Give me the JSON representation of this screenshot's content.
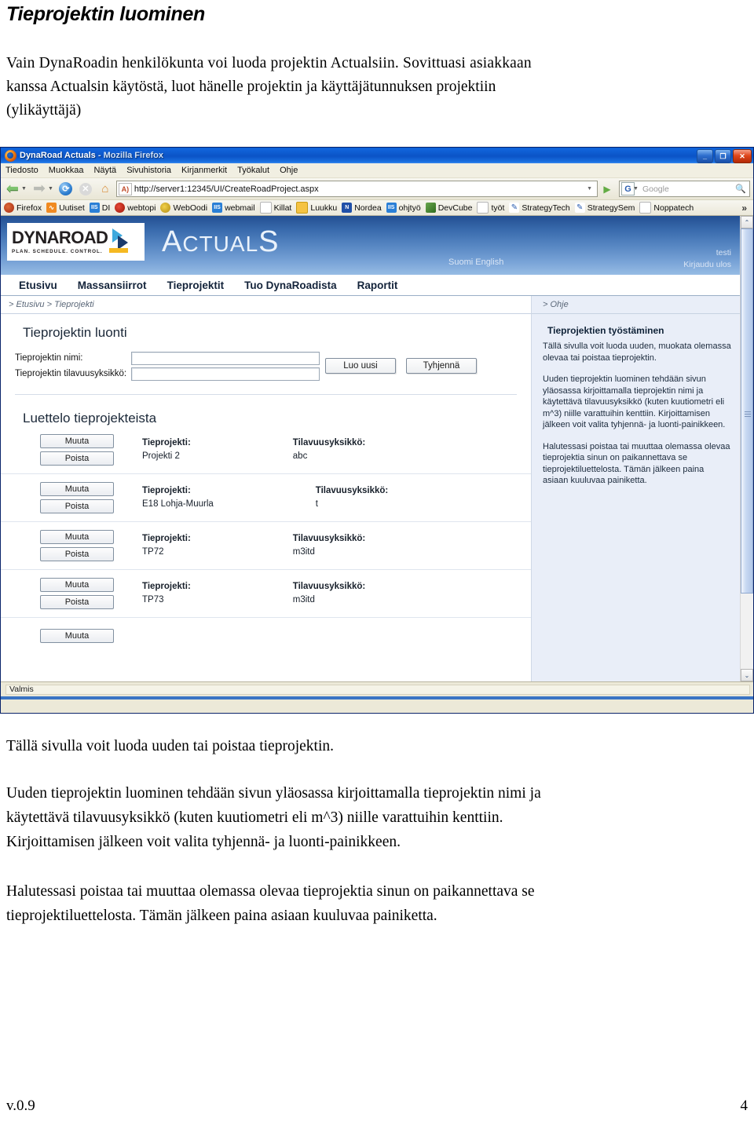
{
  "document": {
    "title": "Tieprojektin luominen",
    "intro_lines": [
      "Vain DynaRoadin henkilökunta voi luoda projektin Actualsiin. Sovittuasi asiakkaan",
      "kanssa Actualsin käytöstä, luot hänelle projektin ja käyttäjätunnuksen projektiin",
      "(ylikäyttäjä)"
    ],
    "paragraph1": "Tällä sivulla voit luoda uuden tai poistaa tieprojektin.",
    "paragraph2_lines": [
      "Uuden tieprojektin luominen tehdään sivun yläosassa kirjoittamalla tieprojektin nimi ja",
      "käytettävä tilavuusyksikkö (kuten kuutiometri eli m^3) niille varattuihin kenttiin.",
      "Kirjoittamisen jälkeen voit valita tyhjennä- ja luonti-painikkeen."
    ],
    "paragraph3_lines": [
      "Halutessasi poistaa tai muuttaa olemassa olevaa tieprojektia sinun on paikannettava se",
      "tieprojektiluettelosta. Tämän jälkeen paina asiaan kuuluvaa painiketta."
    ],
    "footer": {
      "version": "v.0.9",
      "page_number": "4"
    }
  },
  "browser": {
    "window_title": "DynaRoad Actuals",
    "window_title_suffix": " - Mozilla Firefox",
    "window_buttons": {
      "minimize": "_",
      "maximize": "❐",
      "close": "✕"
    },
    "menus": [
      "Tiedosto",
      "Muokkaa",
      "Näytä",
      "Sivuhistoria",
      "Kirjanmerkit",
      "Työkalut",
      "Ohje"
    ],
    "toolbar": {
      "back_icon": "back-arrow-icon",
      "forward_icon": "forward-arrow-icon",
      "reload_icon": "reload-icon",
      "stop_icon": "stop-icon",
      "home_icon": "home-icon",
      "url": "http://server1:12345/UI/CreateRoadProject.aspx",
      "favicon_label": "A)",
      "go_icon": "▶",
      "search_engine": "G",
      "search_placeholder": "Google",
      "search_icon": "search-icon"
    },
    "bookmarks": [
      {
        "label": "Firefox",
        "icon": "firefox-icon"
      },
      {
        "label": "Uutiset",
        "icon": "rss-icon"
      },
      {
        "label": "DI",
        "icon": "iis-icon"
      },
      {
        "label": "webtopi",
        "icon": "red-circle-icon"
      },
      {
        "label": "WebOodi",
        "icon": "oodi-icon"
      },
      {
        "label": "webmail",
        "icon": "iis-icon"
      },
      {
        "label": "Killat",
        "icon": "page-icon"
      },
      {
        "label": "Luukku",
        "icon": "yellow-folder-icon"
      },
      {
        "label": "Nordea",
        "icon": "nordea-icon"
      },
      {
        "label": "ohjtyö",
        "icon": "iis-icon"
      },
      {
        "label": "DevCube",
        "icon": "devcube-icon"
      },
      {
        "label": "työt",
        "icon": "page-icon"
      },
      {
        "label": "StrategyTech",
        "icon": "pen-icon"
      },
      {
        "label": "StrategySem",
        "icon": "pen-icon"
      },
      {
        "label": "Noppatech",
        "icon": "page-icon"
      }
    ],
    "bookmarks_overflow": "»",
    "status_text": "Valmis"
  },
  "webapp": {
    "brand": {
      "name": "DYNAROAD",
      "tagline": "PLAN. SCHEDULE. CONTROL.",
      "product_a": "A",
      "product_rest": "CTUAL",
      "product_end": "S"
    },
    "language_links": "Suomi English",
    "user": {
      "name": "testi",
      "logout": "Kirjaudu ulos"
    },
    "nav_tabs": [
      "Etusivu",
      "Massansiirrot",
      "Tieprojektit",
      "Tuo DynaRoadista",
      "Raportit"
    ],
    "breadcrumb": "> Etusivu > Tieprojekti",
    "help_breadcrumb": "> Ohje",
    "create_panel": {
      "title": "Tieprojektin luonti",
      "name_label": "Tieprojektin nimi:",
      "name_value": "",
      "unit_label": "Tieprojektin tilavuusyksikkö:",
      "unit_value": "",
      "create_button": "Luo uusi",
      "clear_button": "Tyhjennä"
    },
    "list_panel": {
      "title": "Luettelo tieprojekteista",
      "edit_button": "Muuta",
      "delete_button": "Poista",
      "project_header": "Tieprojekti:",
      "unit_header": "Tilavuusyksikkö:",
      "rows": [
        {
          "project": "Projekti 2",
          "unit": "abc"
        },
        {
          "project": "E18 Lohja-Muurla",
          "unit": "t"
        },
        {
          "project": "TP72",
          "unit": "m3itd"
        },
        {
          "project": "TP73",
          "unit": "m3itd"
        }
      ]
    },
    "help_panel": {
      "heading": "Tieprojektien työstäminen",
      "paragraphs": [
        "Tällä sivulla voit luoda uuden, muokata olemassa olevaa tai poistaa tieprojektin.",
        "Uuden tieprojektin luominen tehdään sivun yläosassa kirjoittamalla tieprojektin nimi ja käytettävä tilavuusyksikkö (kuten kuutiometri eli m^3) niille varattuihin kenttiin. Kirjoittamisen jälkeen voit valita tyhjennä- ja luonti-painikkeen.",
        "Halutessasi poistaa tai muuttaa olemassa olevaa tieprojektia sinun on paikannettava se tieprojektiluettelosta. Tämän jälkeen paina asiaan kuuluvaa painiketta."
      ]
    },
    "scrollbar": {
      "up": "⌃",
      "down": "⌄"
    }
  },
  "colors": {
    "titlebar_blue": "#0b53c6",
    "header_blue": "#3a6cae",
    "help_panel_bg": "#e9eef8",
    "accent_yellow": "#f5b922",
    "logo_cyan": "#3fa9dd"
  }
}
